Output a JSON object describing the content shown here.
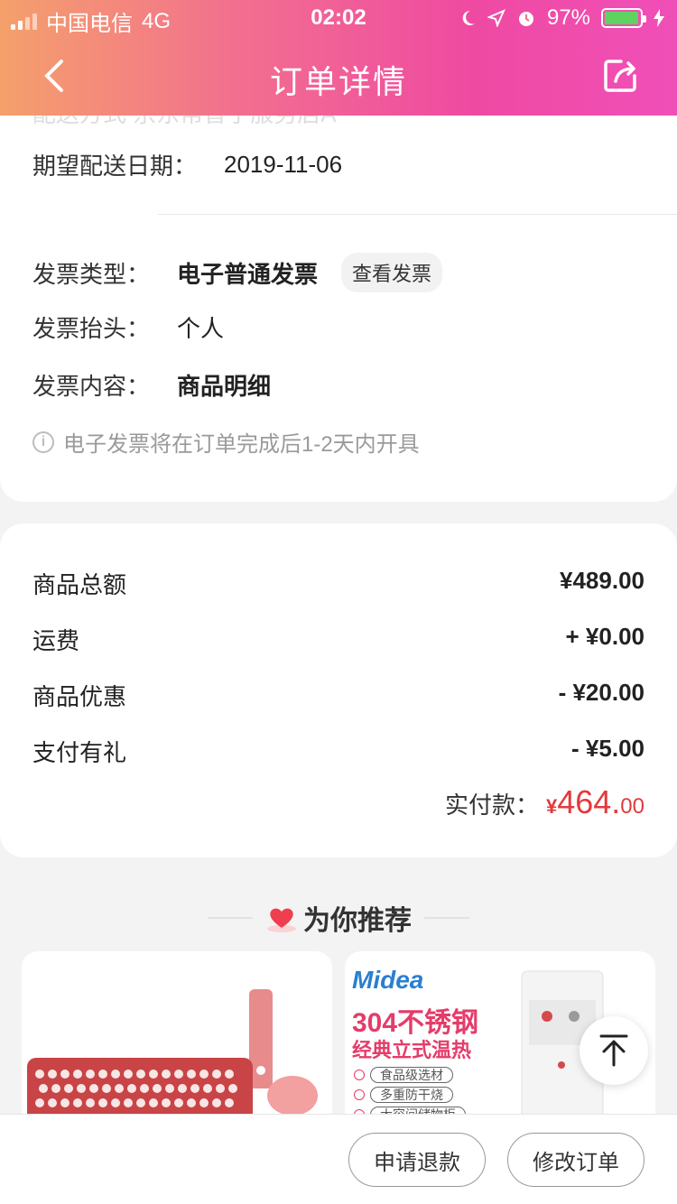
{
  "status": {
    "carrier": "中国电信",
    "network": "4G",
    "time": "02:02",
    "battery": "97%"
  },
  "nav": {
    "title": "订单详情"
  },
  "delivery": {
    "partial_text": "配送方式  京东帮普宁服务店A",
    "date_label": "期望配送日期：",
    "date_value": "2019-11-06"
  },
  "invoice": {
    "type_label": "发票类型：",
    "type_value": "电子普通发票",
    "view_button": "查看发票",
    "title_label": "发票抬头：",
    "title_value": "个人",
    "content_label": "发票内容：",
    "content_value": "商品明细",
    "note": "电子发票将在订单完成后1-2天内开具"
  },
  "amounts": {
    "items": [
      {
        "label": "商品总额",
        "value": "¥489.00"
      },
      {
        "label": "运费",
        "value": "+ ¥0.00"
      },
      {
        "label": "商品优惠",
        "value": "- ¥20.00"
      },
      {
        "label": "支付有礼",
        "value": "- ¥5.00"
      }
    ],
    "paid_label": "实付款：",
    "paid_symbol": "¥",
    "paid_int": "464.",
    "paid_dec": "00",
    "accent": "#e4393c"
  },
  "recommend": {
    "title": "为你推荐",
    "right_card": {
      "brand": "Midea",
      "headline": "304不锈钢",
      "subline": "经典立式温热",
      "features": [
        "食品级选材",
        "多重防干烧",
        "大容间储物柜"
      ]
    }
  },
  "bottom": {
    "refund": "申请退款",
    "modify": "修改订单"
  }
}
